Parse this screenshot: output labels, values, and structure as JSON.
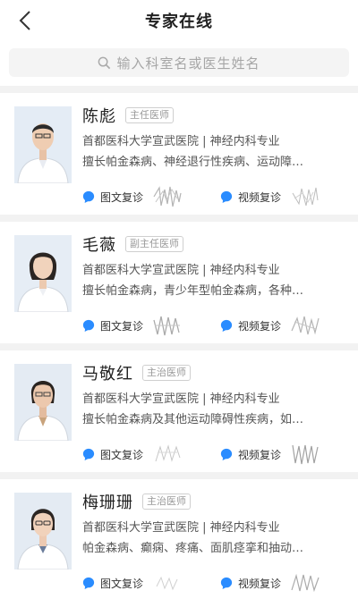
{
  "nav": {
    "title": "专家在线",
    "back_icon": "chevron-left-icon"
  },
  "search": {
    "placeholder": "输入科室名或医生姓名",
    "icon": "search-icon"
  },
  "colors": {
    "accent": "#2a8cff",
    "tag_border": "#cfcfcf",
    "bg": "#f2f2f2"
  },
  "doctors": [
    {
      "name": "陈彪",
      "title": "主任医师",
      "hospital": "首都医科大学宣武医院 | 神经内科专业",
      "specialty": "擅长帕金森病、神经退行性疾病、运动障…",
      "services": [
        "图文复诊",
        "视频复诊"
      ]
    },
    {
      "name": "毛薇",
      "title": "副主任医师",
      "hospital": "首都医科大学宣武医院 | 神经内科专业",
      "specialty": "擅长帕金森病，青少年型帕金森病，各种…",
      "services": [
        "图文复诊",
        "视频复诊"
      ]
    },
    {
      "name": "马敬红",
      "title": "主治医师",
      "hospital": "首都医科大学宣武医院 | 神经内科专业",
      "specialty": "擅长帕金森病及其他运动障碍性疾病，如…",
      "services": [
        "图文复诊",
        "视频复诊"
      ]
    },
    {
      "name": "梅珊珊",
      "title": "主治医师",
      "hospital": "首都医科大学宣武医院 | 神经内科专业",
      "specialty": "帕金森病、癫痫、疼痛、面肌痉挛和抽动…",
      "services": [
        "图文复诊",
        "视频复诊"
      ]
    }
  ]
}
